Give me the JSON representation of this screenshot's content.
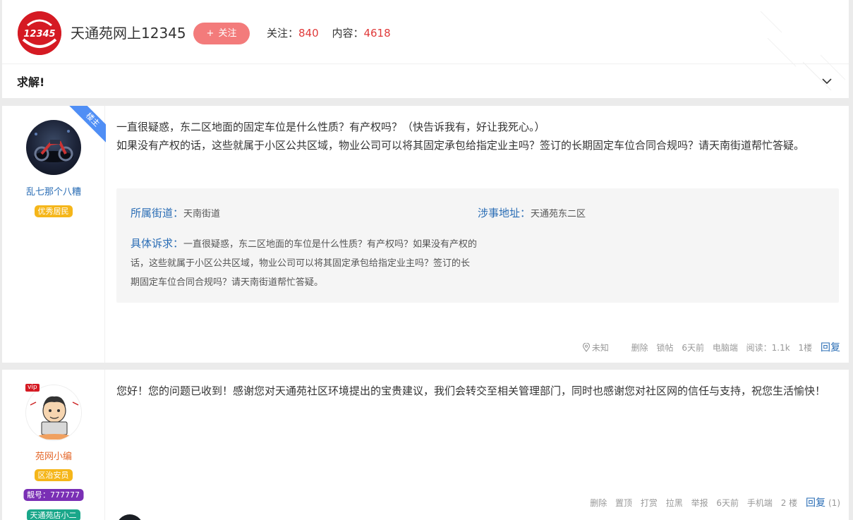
{
  "header": {
    "title": "天通苑网上12345",
    "logo_text": "12345",
    "follow_label": "关注",
    "stats": [
      {
        "label": "关注：",
        "value": "840"
      },
      {
        "label": "内容：",
        "value": "4618"
      }
    ],
    "section_title": "求解!"
  },
  "posts": [
    {
      "author": "乱七那个八糟",
      "badges": [
        "优秀居民"
      ],
      "ribbon": "楼主",
      "text": "一直很疑惑，东二区地面的固定车位是什么性质？有产权吗？（快告诉我有，好让我死心。）\n如果没有产权的话，这些就属于小区公共区域，物业公司可以将其固定承包给指定业主吗？签订的长期固定车位合同合规吗？请天南街道帮忙答疑。",
      "info": {
        "street_label": "所属街道：",
        "street_value": "天南街道",
        "addr_label": "涉事地址：",
        "addr_value": "天通苑东二区",
        "req_label": "具体诉求：",
        "req_value": "一直很疑惑，东二区地面的车位是什么性质？有产权吗？如果没有产权的话，这些就属于小区公共区域，物业公司可以将其固定承包给指定业主吗？签订的长期固定车位合同合规吗？请天南街道帮忙答疑。"
      },
      "meta": {
        "location": "未知",
        "delete": "删除",
        "lock": "锁帖",
        "time": "6天前",
        "device": "电脑端",
        "reads": "阅读：1.1k",
        "floor": "1楼",
        "reply": "回复"
      }
    },
    {
      "author": "苑网小编",
      "vip": "vip",
      "badges": [
        "区治安员",
        "靓号：777777",
        "天通苑店小二"
      ],
      "text": "您好！您的问题已收到！感谢您对天通苑社区环境提出的宝贵建议，我们会转交至相关管理部门，同时也感谢您对社区网的信任与支持，祝您生活愉快！",
      "meta": {
        "delete": "删除",
        "pin": "置顶",
        "tip": "打赏",
        "block": "拉黑",
        "report": "举报",
        "time": "6天前",
        "device": "手机端",
        "floor": "2 楼",
        "reply": "回复",
        "reply_count": "(1)"
      }
    }
  ],
  "colors": {
    "accent_red": "#e03a3a",
    "link_blue": "#2a6db5",
    "follow_btn": "#f37b7b",
    "ribbon_blue": "#4f8ef5",
    "badge_gold": "#f5b61a"
  }
}
